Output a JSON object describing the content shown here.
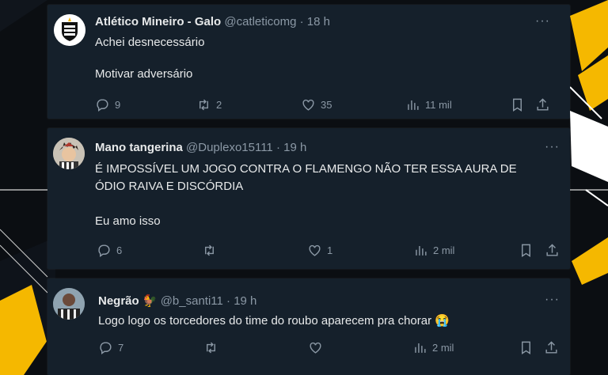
{
  "tweets": [
    {
      "name": "Atlético Mineiro - Galo",
      "handle": "@catleticomg",
      "time": "· 18 h",
      "lines": [
        "Achei desnecessário",
        "",
        "Motivar adversário"
      ],
      "replies": "9",
      "retweets": "2",
      "likes": "35",
      "views": "11 mil",
      "avatar": "crest-avatar"
    },
    {
      "name": "Mano tangerina",
      "handle": "@Duplexo15111",
      "time": "· 19 h",
      "lines": [
        "É IMPOSSÍVEL UM JOGO CONTRA O FLAMENGO NÃO TER ESSA AURA DE",
        "ÓDIO RAIVA E DISCÓRDIA",
        "",
        "Eu amo isso"
      ],
      "replies": "6",
      "retweets": "",
      "likes": "1",
      "views": "2 mil",
      "avatar": "cartoon-avatar"
    },
    {
      "name": "Negrão 🐓",
      "handle": "@b_santi11",
      "time": "· 19 h",
      "lines": [
        "Logo logo os torcedores do time do roubo aparecem pra chorar 😭"
      ],
      "replies": "7",
      "retweets": "",
      "likes": "",
      "views": "2 mil",
      "avatar": "photo-avatar"
    }
  ],
  "more_glyph": "···",
  "colors": {
    "card": "#15202b",
    "text": "#e7e9ea",
    "muted": "#8b98a5",
    "accent": "#f5b800",
    "background": "#0b0e12"
  }
}
